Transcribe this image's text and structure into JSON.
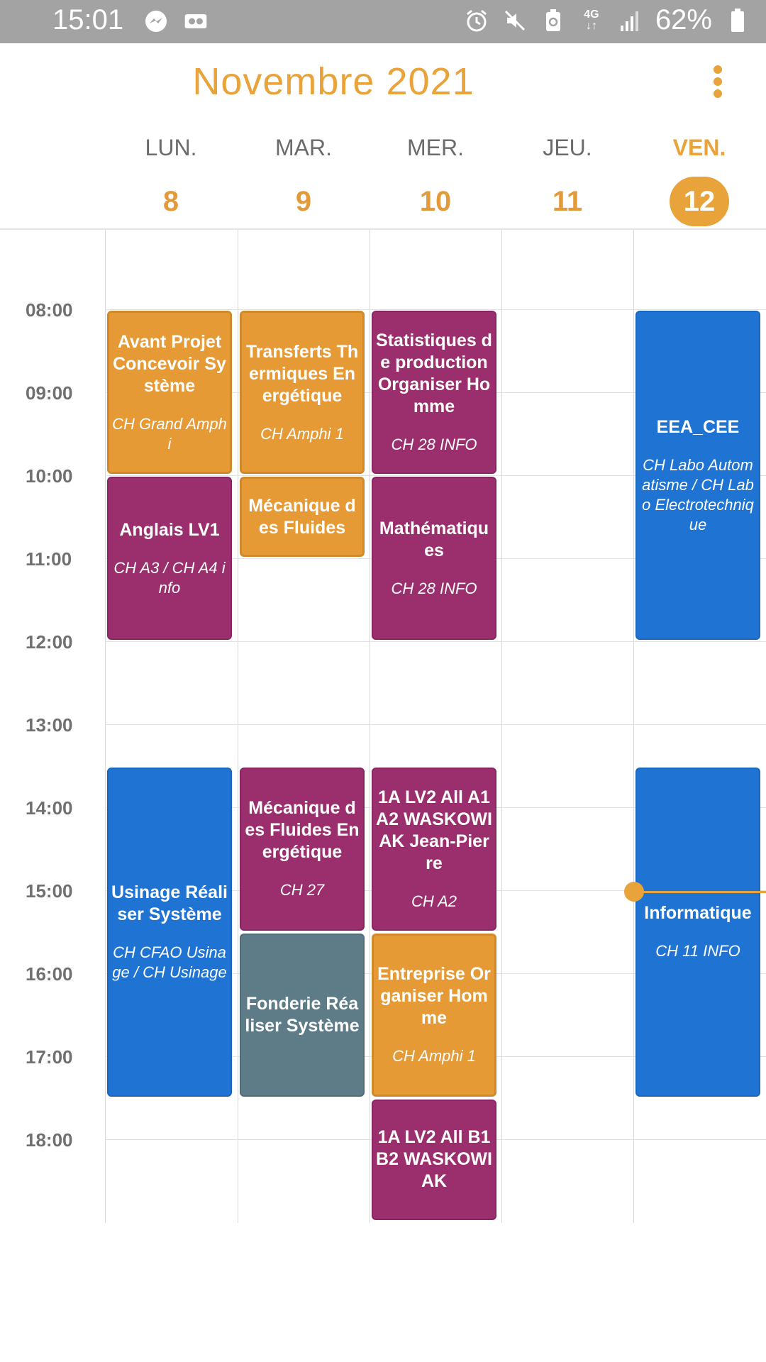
{
  "status_bar": {
    "time": "15:01",
    "left_icons": [
      "messenger-icon",
      "voicemail-icon"
    ],
    "right_icons": [
      "alarm-icon",
      "mute-icon",
      "battery-saver-icon",
      "network-4g-icon",
      "signal-icon"
    ],
    "network": "4G",
    "battery": "62%"
  },
  "header": {
    "title": "Novembre 2021",
    "menu_icon": "more-vert-icon"
  },
  "days": [
    {
      "name": "LUN.",
      "number": "8",
      "today": false
    },
    {
      "name": "MAR.",
      "number": "9",
      "today": false
    },
    {
      "name": "MER.",
      "number": "10",
      "today": false
    },
    {
      "name": "JEU.",
      "number": "11",
      "today": false
    },
    {
      "name": "VEN.",
      "number": "12",
      "today": true
    }
  ],
  "hours": [
    "08:00",
    "09:00",
    "10:00",
    "11:00",
    "12:00",
    "13:00",
    "14:00",
    "15:00",
    "16:00",
    "17:00",
    "18:00"
  ],
  "colors": {
    "accent": "#e8a33a",
    "orange": "#e69a36",
    "purple": "#9b2f6e",
    "blue": "#1f74d3",
    "gray": "#5e7b88"
  },
  "current_time": "15:01",
  "events": [
    {
      "day": 0,
      "start": "08:00",
      "end": "10:00",
      "color": "orange",
      "title": "Avant Projet Concevoir Système",
      "location": "CH Grand Amphi"
    },
    {
      "day": 0,
      "start": "10:00",
      "end": "12:00",
      "color": "purple",
      "title": "Anglais LV1",
      "location": "CH A3 / CH A4  info"
    },
    {
      "day": 0,
      "start": "13:30",
      "end": "17:30",
      "color": "blue",
      "title": "Usinage Réaliser Système",
      "location": "CH CFAO Usinage / CH Usinage"
    },
    {
      "day": 1,
      "start": "08:00",
      "end": "10:00",
      "color": "orange",
      "title": "Transferts Thermiques Energétique",
      "location": "CH Amphi 1"
    },
    {
      "day": 1,
      "start": "10:00",
      "end": "11:00",
      "color": "orange",
      "title": "Mécanique des Fluides",
      "location": ""
    },
    {
      "day": 1,
      "start": "13:30",
      "end": "15:30",
      "color": "purple",
      "title": "Mécanique des Fluides Energétique",
      "location": "CH 27"
    },
    {
      "day": 1,
      "start": "15:30",
      "end": "17:30",
      "color": "gray",
      "title": "Fonderie Réaliser Système",
      "location": ""
    },
    {
      "day": 2,
      "start": "08:00",
      "end": "10:00",
      "color": "purple",
      "title": "Statistiques de production Organiser Homme",
      "location": "CH 28 INFO"
    },
    {
      "day": 2,
      "start": "10:00",
      "end": "12:00",
      "color": "purple",
      "title": "Mathématiques",
      "location": "CH 28 INFO"
    },
    {
      "day": 2,
      "start": "13:30",
      "end": "15:30",
      "color": "purple",
      "title": "1A LV2 All A1 A2 WASKOWIAK Jean-Pierre",
      "location": "CH A2"
    },
    {
      "day": 2,
      "start": "15:30",
      "end": "17:30",
      "color": "orange",
      "title": "Entreprise Organiser Homme",
      "location": "CH Amphi 1"
    },
    {
      "day": 2,
      "start": "17:30",
      "end": "19:00",
      "color": "purple",
      "title": "1A LV2 All B1B2 WASKOWIAK",
      "location": ""
    },
    {
      "day": 4,
      "start": "08:00",
      "end": "12:00",
      "color": "blue",
      "title": "EEA_CEE",
      "location": "CH Labo Automatisme / CH Labo Electrotechnique"
    },
    {
      "day": 4,
      "start": "13:30",
      "end": "17:30",
      "color": "blue",
      "title": "Informatique",
      "location": "CH 11 INFO"
    }
  ]
}
